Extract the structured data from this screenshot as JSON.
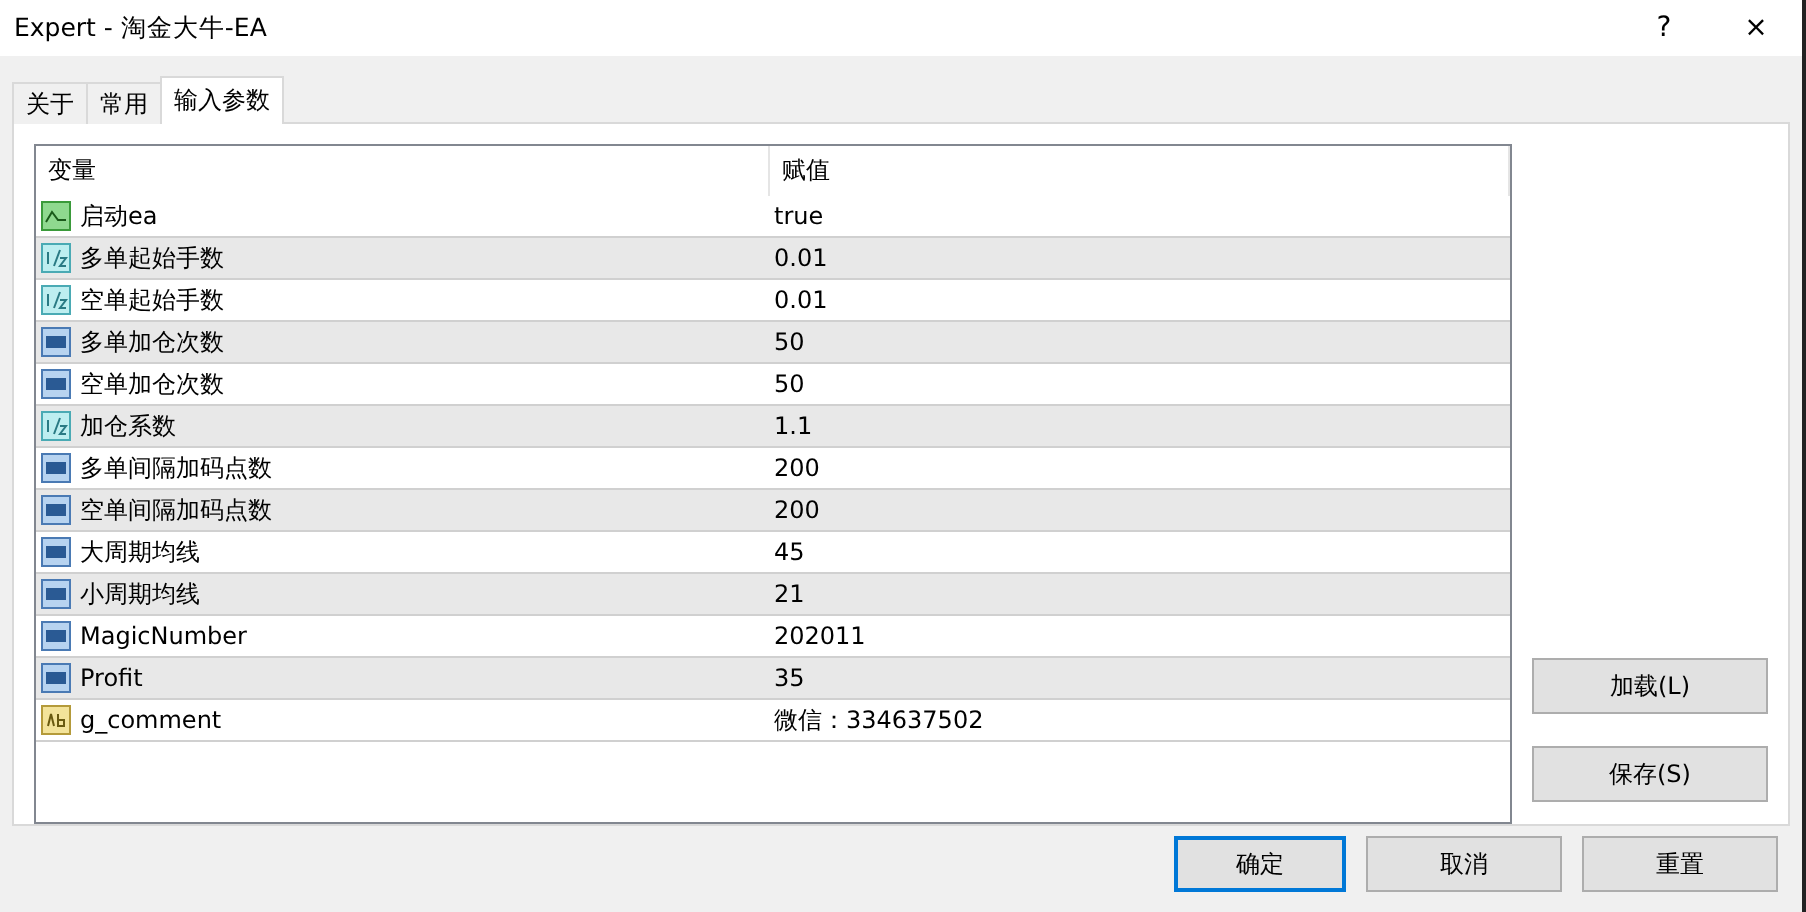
{
  "window": {
    "title": "Expert - 淘金大牛-EA",
    "help": "?",
    "close": "×"
  },
  "tabs": [
    {
      "label": "关于",
      "selected": false
    },
    {
      "label": "常用",
      "selected": false
    },
    {
      "label": "输入参数",
      "selected": true
    }
  ],
  "table": {
    "columns": [
      "变量",
      "赋值"
    ],
    "rows": [
      {
        "kind": "bool",
        "name": "启动ea",
        "value": "true"
      },
      {
        "kind": "double",
        "name": "多单起始手数",
        "value": "0.01"
      },
      {
        "kind": "double",
        "name": "空单起始手数",
        "value": "0.01"
      },
      {
        "kind": "int",
        "name": "多单加仓次数",
        "value": "50"
      },
      {
        "kind": "int",
        "name": "空单加仓次数",
        "value": "50"
      },
      {
        "kind": "double",
        "name": "加仓系数",
        "value": "1.1"
      },
      {
        "kind": "int",
        "name": "多单间隔加码点数",
        "value": "200"
      },
      {
        "kind": "int",
        "name": "空单间隔加码点数",
        "value": "200"
      },
      {
        "kind": "int",
        "name": "大周期均线",
        "value": "45"
      },
      {
        "kind": "int",
        "name": "小周期均线",
        "value": "21"
      },
      {
        "kind": "int",
        "name": "MagicNumber",
        "value": "202011"
      },
      {
        "kind": "int",
        "name": "Profit",
        "value": "35"
      },
      {
        "kind": "string",
        "name": "g_comment",
        "value": "微信：334637502"
      }
    ]
  },
  "side_buttons": [
    "加载(L)",
    "保存(S)"
  ],
  "buttons": [
    {
      "label": "确定",
      "focused": true
    },
    {
      "label": "取消",
      "focused": false
    },
    {
      "label": "重置",
      "focused": false
    }
  ]
}
